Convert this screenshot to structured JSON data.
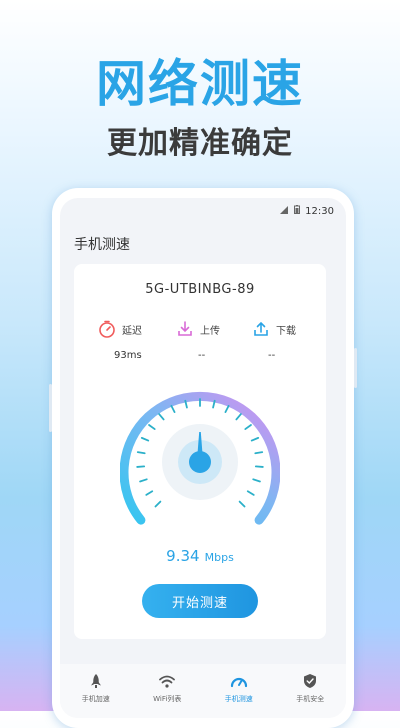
{
  "hero": {
    "title": "网络测速",
    "subtitle": "更加精准确定"
  },
  "status_bar": {
    "time": "12:30"
  },
  "app": {
    "title": "手机测速"
  },
  "card": {
    "network_name": "5G-UTBINBG-89",
    "metrics": [
      {
        "label": "延迟",
        "value": "93ms",
        "icon": "timer-icon",
        "color": "#f05b5b"
      },
      {
        "label": "上传",
        "value": "--",
        "icon": "upload-tray-icon",
        "color": "#d86bd6"
      },
      {
        "label": "下载",
        "value": "--",
        "icon": "download-tray-icon",
        "color": "#2aa4e6"
      }
    ],
    "speed_value": "9.34",
    "speed_unit": "Mbps",
    "start_button": "开始测速"
  },
  "tabs": [
    {
      "label": "手机加速",
      "icon": "rocket-icon",
      "active": false
    },
    {
      "label": "WiFi列表",
      "icon": "wifi-icon",
      "active": false
    },
    {
      "label": "手机测速",
      "icon": "speedometer-icon",
      "active": true
    },
    {
      "label": "手机安全",
      "icon": "shield-icon",
      "active": false
    }
  ],
  "colors": {
    "accent": "#29a3e5",
    "gauge_start": "#34c6f0",
    "gauge_end": "#d78ef0"
  }
}
